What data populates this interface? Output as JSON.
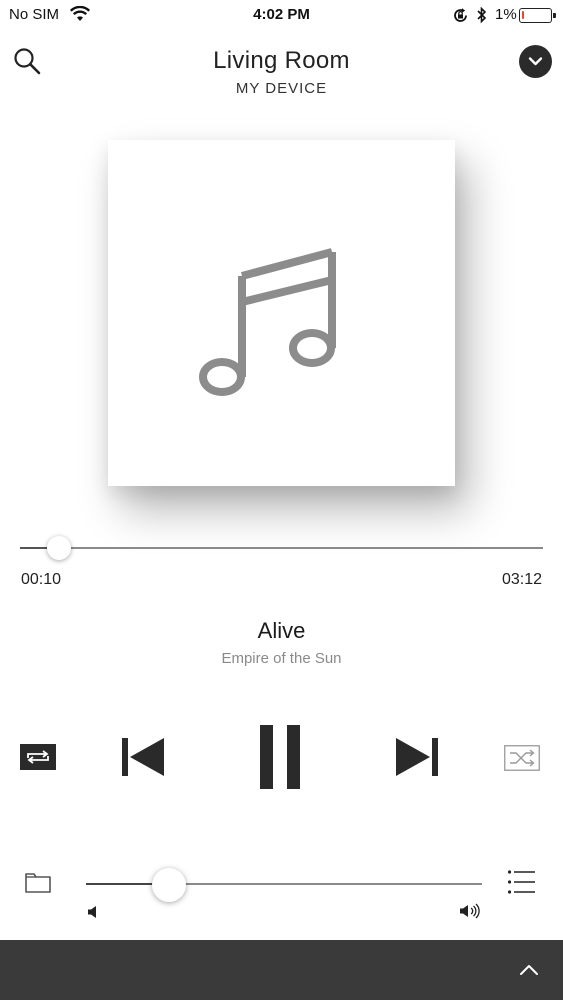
{
  "status_bar": {
    "carrier": "No SIM",
    "time": "4:02 PM",
    "battery_percent_label": "1%",
    "battery_level": 0.01,
    "battery_color": "#e64a2e",
    "icons": [
      "wifi-icon",
      "orientation-lock-icon",
      "bluetooth-icon",
      "battery-icon"
    ]
  },
  "header": {
    "title": "Living Room",
    "subtitle": "MY DEVICE",
    "left_icon": "search-icon",
    "right_icon": "chevron-down-icon"
  },
  "album_art": {
    "placeholder_icon": "music-note-icon"
  },
  "playback": {
    "elapsed": "00:10",
    "total": "03:12",
    "progress_fraction": 0.052
  },
  "track": {
    "title": "Alive",
    "artist": "Empire of the Sun"
  },
  "controls": {
    "repeat_icon": "repeat-icon",
    "previous_icon": "skip-previous-icon",
    "play_state_icon": "pause-icon",
    "next_icon": "skip-next-icon",
    "shuffle_icon": "shuffle-icon"
  },
  "volume": {
    "level_fraction": 0.21,
    "low_icon": "volume-low-icon",
    "high_icon": "volume-high-icon"
  },
  "bottom": {
    "left_icon": "folder-icon",
    "right_icon": "queue-list-icon",
    "bar_icon": "chevron-up-icon",
    "bar_color": "#3a3a3a"
  }
}
